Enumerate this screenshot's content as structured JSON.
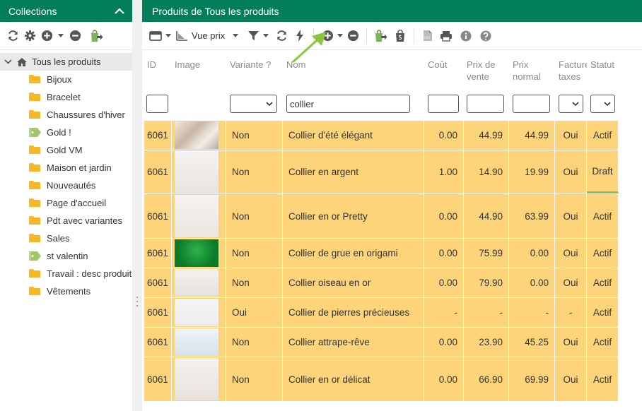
{
  "left": {
    "title": "Collections",
    "root_label": "Tous les produits",
    "items": [
      {
        "label": "Bijoux",
        "icon": "folder-icon"
      },
      {
        "label": "Bracelet",
        "icon": "folder-icon"
      },
      {
        "label": "Chaussures d'hiver",
        "icon": "folder-icon"
      },
      {
        "label": "Gold !",
        "icon": "tag-icon"
      },
      {
        "label": "Gold VM",
        "icon": "folder-icon"
      },
      {
        "label": "Maison et jardin",
        "icon": "folder-icon"
      },
      {
        "label": "Nouveautés",
        "icon": "folder-icon"
      },
      {
        "label": "Page d'accueil",
        "icon": "folder-icon"
      },
      {
        "label": "Pdt avec variantes",
        "icon": "folder-icon"
      },
      {
        "label": "Sales",
        "icon": "folder-icon"
      },
      {
        "label": "st valentin",
        "icon": "tag-icon"
      },
      {
        "label": "Travail : desc produit",
        "icon": "folder-icon"
      },
      {
        "label": "Vêtements",
        "icon": "folder-icon"
      }
    ]
  },
  "right": {
    "title": "Produits de Tous les produits",
    "view_label": "Vue prix"
  },
  "columns": {
    "id": "ID",
    "image": "Image",
    "variante": "Variante ?",
    "nom": "Nom",
    "cout": "Coût",
    "prix_vente": "Prix de vente",
    "prix_normal": "Prix normal",
    "facturer": "Facturer taxes",
    "statut": "Statut"
  },
  "filters": {
    "nom": "collier"
  },
  "rows": [
    {
      "id": "6061",
      "variante": "Non",
      "nom": "Collier d'été élégant",
      "cout": "0.00",
      "prix_vente": "44.99",
      "prix_normal": "44.99",
      "taxes": "Oui",
      "statut": "Actif"
    },
    {
      "id": "6061",
      "variante": "Non",
      "nom": "Collier en argent",
      "cout": "1.00",
      "prix_vente": "14.90",
      "prix_normal": "19.99",
      "taxes": "Oui",
      "statut": "Draft"
    },
    {
      "id": "6061",
      "variante": "Non",
      "nom": "Collier en or Pretty",
      "cout": "0.00",
      "prix_vente": "44.90",
      "prix_normal": "63.99",
      "taxes": "Oui",
      "statut": "Actif"
    },
    {
      "id": "6061",
      "variante": "Non",
      "nom": "Collier de grue en origami",
      "cout": "0.00",
      "prix_vente": "75.99",
      "prix_normal": "0.00",
      "taxes": "Oui",
      "statut": "Actif"
    },
    {
      "id": "6061",
      "variante": "Non",
      "nom": "Collier oiseau en or",
      "cout": "0.00",
      "prix_vente": "79.90",
      "prix_normal": "0.00",
      "taxes": "Oui",
      "statut": "Actif"
    },
    {
      "id": "6061",
      "variante": "Oui",
      "nom": "Collier de pierres précieuses",
      "cout": "-",
      "prix_vente": "-",
      "prix_normal": "-",
      "taxes": "-",
      "statut": "Actif"
    },
    {
      "id": "6061",
      "variante": "Non",
      "nom": "Collier attrape-rêve",
      "cout": "0.00",
      "prix_vente": "23.90",
      "prix_normal": "45.25",
      "taxes": "Oui",
      "statut": "Actif"
    },
    {
      "id": "6061",
      "variante": "Non",
      "nom": "Collier en or délicat",
      "cout": "0.00",
      "prix_vente": "66.90",
      "prix_normal": "69.99",
      "taxes": "Oui",
      "statut": "Actif"
    }
  ],
  "colors": {
    "header_green": "#027e5b",
    "row_yellow": "#fdd47a",
    "accent_green": "#8cc63f"
  }
}
